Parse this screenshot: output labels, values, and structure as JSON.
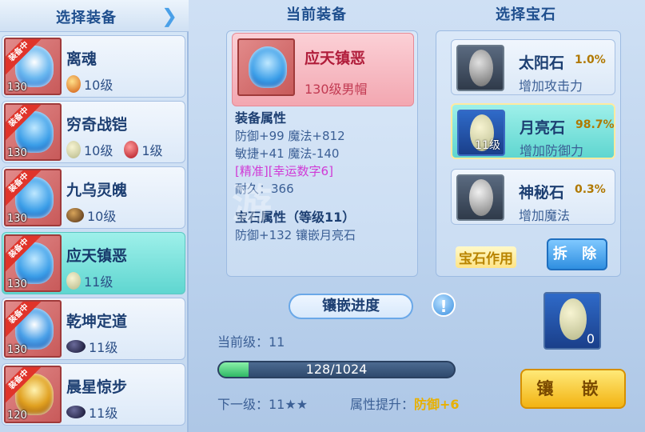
{
  "left_panel": {
    "title": "选择装备",
    "items": [
      {
        "name": "离魂",
        "level": "130",
        "badge": "装备中",
        "gems": [
          {
            "type": "orange",
            "label": "10级"
          }
        ]
      },
      {
        "name": "穷奇战铠",
        "level": "130",
        "badge": "装备中",
        "gems": [
          {
            "type": "moon",
            "label": "10级"
          },
          {
            "type": "red",
            "label": "1级"
          }
        ]
      },
      {
        "name": "九乌灵魄",
        "level": "130",
        "badge": "装备中",
        "gems": [
          {
            "type": "brown",
            "label": "10级"
          }
        ]
      },
      {
        "name": "应天镇恶",
        "level": "130",
        "badge": "装备中",
        "gems": [
          {
            "type": "moon",
            "label": "11级"
          }
        ],
        "selected": true
      },
      {
        "name": "乾坤定道",
        "level": "130",
        "badge": "装备中",
        "gems": [
          {
            "type": "black",
            "label": "11级"
          }
        ]
      },
      {
        "name": "晨星惊步",
        "level": "120",
        "badge": "装备中",
        "gems": [
          {
            "type": "black",
            "label": "11级"
          }
        ]
      }
    ]
  },
  "current_equip": {
    "header": "当前装备",
    "name": "应天镇恶",
    "subtitle": "130级男帽",
    "attr_header": "装备属性",
    "attr_lines": [
      "防御+99 魔法+812",
      "敏捷+41 魔法-140"
    ],
    "special": "[精准][幸运数字6]",
    "durability": "耐久：366",
    "gem_attr_header": "宝石属性（等级11）",
    "gem_attr_line": "防御+132 镶嵌月亮石"
  },
  "gem_select": {
    "header": "选择宝石",
    "stones": [
      {
        "name": "太阳石",
        "pct": "1.0%",
        "desc": "增加攻击力",
        "level": ""
      },
      {
        "name": "月亮石",
        "pct": "98.7%",
        "desc": "增加防御力",
        "level": "11级",
        "selected": true
      },
      {
        "name": "神秘石",
        "pct": "0.3%",
        "desc": "增加魔法",
        "level": ""
      }
    ],
    "effect_label": "宝石作用",
    "remove_label": "拆 除"
  },
  "progress": {
    "title": "镶嵌进度",
    "current_level": "当前级：11",
    "value": 128,
    "max": 1024,
    "text": "128/1024",
    "next_level": "下一级：11★★",
    "boost_label": "属性提升：",
    "boost_value": "防御+6"
  },
  "slot": {
    "count": "0"
  },
  "inlay_button": "镶 嵌",
  "watermark": "游",
  "colors": {
    "selected": "#5fd6d0",
    "badge": "#e0342a",
    "gold": "#e8b000"
  }
}
